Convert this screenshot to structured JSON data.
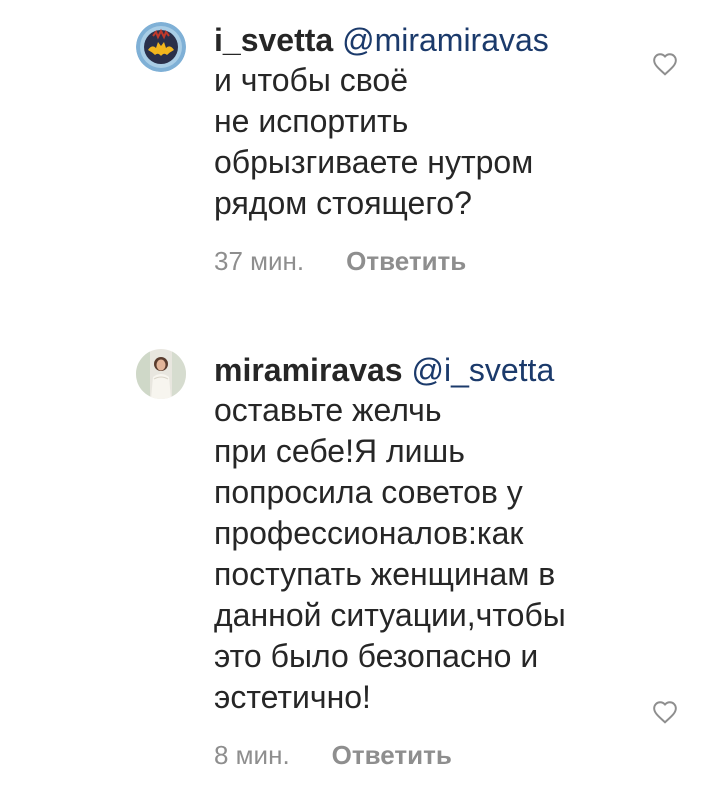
{
  "comments": [
    {
      "username": "i_svetta",
      "mention": "@miramiravas",
      "text": "и чтобы своё\nне испортить\nобрызгиваете нутром\nрядом стоящего?",
      "time": "37 мин.",
      "reply_label": "Ответить"
    },
    {
      "username": "miramiravas",
      "mention": "@i_svetta",
      "text": "оставьте желчь\nпри себе!Я лишь\nпопросила советов у\nпрофессионалов:как\nпоступать женщинам в\nданной ситуации,чтобы\nэто было безопасно и\nэстетично!",
      "time": "8 мин.",
      "reply_label": "Ответить"
    }
  ],
  "icons": {
    "like": "heart-outline-icon",
    "avatar1": "batman-avatar",
    "avatar2": "user-photo-avatar"
  },
  "colors": {
    "mention": "#1b3a6b",
    "meta": "#8e8e8e",
    "text": "#262626"
  }
}
